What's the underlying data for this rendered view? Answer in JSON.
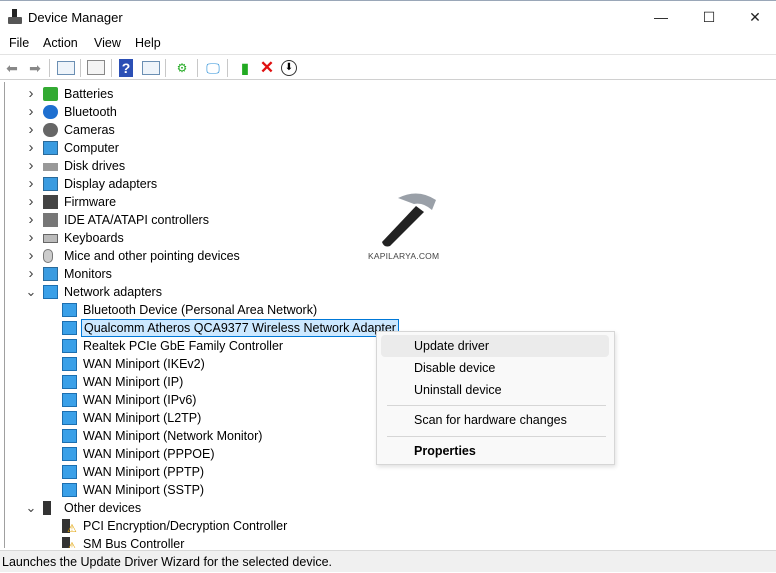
{
  "window": {
    "title": "Device Manager",
    "minimize": "—",
    "maximize": "☐",
    "close": "✕"
  },
  "menu": [
    "File",
    "Action",
    "View",
    "Help"
  ],
  "toolbar": [
    "back-icon",
    "forward-icon",
    "show-hide-console-tree-icon",
    "properties-icon",
    "help-icon",
    "action-pane-icon",
    "update-driver-icon",
    "scan-hardware-icon",
    "enable-device-icon",
    "uninstall-icon",
    "disable-device-icon"
  ],
  "tree": [
    {
      "label": "Batteries",
      "level": 0,
      "expanded": false,
      "icon": "battery"
    },
    {
      "label": "Bluetooth",
      "level": 0,
      "expanded": false,
      "icon": "bluetooth"
    },
    {
      "label": "Cameras",
      "level": 0,
      "expanded": false,
      "icon": "camera"
    },
    {
      "label": "Computer",
      "level": 0,
      "expanded": false,
      "icon": "monitor"
    },
    {
      "label": "Disk drives",
      "level": 0,
      "expanded": false,
      "icon": "disk"
    },
    {
      "label": "Display adapters",
      "level": 0,
      "expanded": false,
      "icon": "display"
    },
    {
      "label": "Firmware",
      "level": 0,
      "expanded": false,
      "icon": "chip"
    },
    {
      "label": "IDE ATA/ATAPI controllers",
      "level": 0,
      "expanded": false,
      "icon": "ide"
    },
    {
      "label": "Keyboards",
      "level": 0,
      "expanded": false,
      "icon": "keyboard"
    },
    {
      "label": "Mice and other pointing devices",
      "level": 0,
      "expanded": false,
      "icon": "mouse"
    },
    {
      "label": "Monitors",
      "level": 0,
      "expanded": false,
      "icon": "monitor"
    },
    {
      "label": "Network adapters",
      "level": 0,
      "expanded": true,
      "icon": "network"
    },
    {
      "label": "Bluetooth Device (Personal Area Network)",
      "level": 1,
      "icon": "network"
    },
    {
      "label": "Qualcomm Atheros QCA9377 Wireless Network Adapter",
      "level": 1,
      "icon": "network",
      "selected": true
    },
    {
      "label": "Realtek PCIe GbE Family Controller",
      "level": 1,
      "icon": "network"
    },
    {
      "label": "WAN Miniport (IKEv2)",
      "level": 1,
      "icon": "network"
    },
    {
      "label": "WAN Miniport (IP)",
      "level": 1,
      "icon": "network"
    },
    {
      "label": "WAN Miniport (IPv6)",
      "level": 1,
      "icon": "network"
    },
    {
      "label": "WAN Miniport (L2TP)",
      "level": 1,
      "icon": "network"
    },
    {
      "label": "WAN Miniport (Network Monitor)",
      "level": 1,
      "icon": "network"
    },
    {
      "label": "WAN Miniport (PPPOE)",
      "level": 1,
      "icon": "network"
    },
    {
      "label": "WAN Miniport (PPTP)",
      "level": 1,
      "icon": "network"
    },
    {
      "label": "WAN Miniport (SSTP)",
      "level": 1,
      "icon": "network"
    },
    {
      "label": "Other devices",
      "level": 0,
      "expanded": true,
      "icon": "unknown"
    },
    {
      "label": "PCI Encryption/Decryption Controller",
      "level": 1,
      "icon": "warning"
    },
    {
      "label": "SM Bus Controller",
      "level": 1,
      "icon": "warning"
    }
  ],
  "context_menu": {
    "items": [
      "Update driver",
      "Disable device",
      "Uninstall device",
      "Scan for hardware changes",
      "Properties"
    ]
  },
  "watermark": "KAPILARYA.COM",
  "status": "Launches the Update Driver Wizard for the selected device.",
  "colors": {
    "selection": "#cce8ff",
    "selection_border": "#0078d7",
    "network_icon": "#2f8fd8"
  }
}
